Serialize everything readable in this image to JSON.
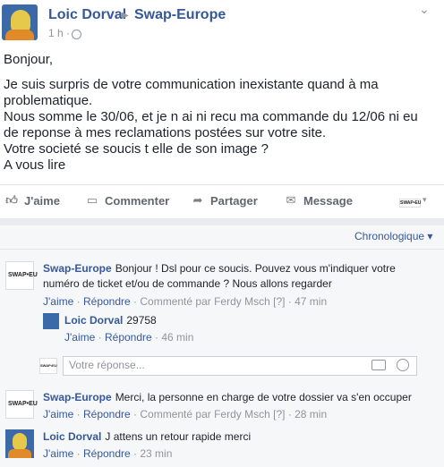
{
  "post": {
    "author": "Loic Dorval",
    "group": "Swap-Europe",
    "time": "1 h",
    "body": [
      "Bonjour,",
      "Je suis surpris de votre communication inexistante quand à ma problematique.",
      "Nous somme le 30/06, et je n ai ni recu ma commande du 12/06 ni eu de reponse à mes reclamations postées sur votre site.",
      "Votre societé se soucis t elle de son image ?",
      "A vous lire"
    ],
    "actions": {
      "like": "J'aime",
      "comment": "Commenter",
      "share": "Partager",
      "message": "Message"
    }
  },
  "comments": {
    "sort_label": "Chronologique",
    "items": [
      {
        "name": "Swap-Europe",
        "text": "Bonjour ! Dsl pour ce soucis. Pouvez vous m'indiquer votre numéro de ticket et/ou de commande ? Nous allons regarder",
        "like": "J'aime",
        "reply": "Répondre",
        "by": "Commenté par Ferdy Msch",
        "bracket": "[?]",
        "time": "47 min"
      },
      {
        "name": "Loic Dorval",
        "text": "29758",
        "like": "J'aime",
        "reply": "Répondre",
        "time": "46 min"
      },
      {
        "name": "Swap-Europe",
        "text": "Merci, la personne en charge de votre dossier va s'en occuper",
        "like": "J'aime",
        "reply": "Répondre",
        "by": "Commenté par Ferdy Msch",
        "bracket": "[?]",
        "time": "28 min"
      },
      {
        "name": "Loic Dorval",
        "text": "J attens un retour rapide merci",
        "like": "J'aime",
        "reply": "Répondre",
        "time": "23 min"
      }
    ],
    "reply_placeholder": "Votre réponse...",
    "logo_text": "SWAP•EU"
  }
}
